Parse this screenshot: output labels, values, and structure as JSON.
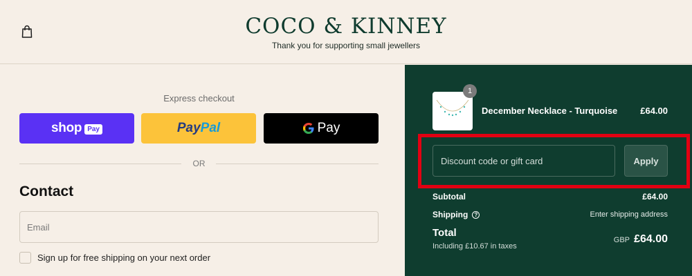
{
  "header": {
    "brand": "COCO & KINNEY",
    "tagline": "Thank you for supporting small jewellers",
    "cart_icon": "shopping-bag-icon"
  },
  "express": {
    "label": "Express checkout",
    "shop_pay": {
      "word": "shop",
      "pill": "Pay",
      "color": "#5a31f4"
    },
    "paypal": {
      "part1": "Pay",
      "part2": "Pal",
      "color": "#fcc33a"
    },
    "google_pay": {
      "word": "Pay",
      "color": "#000000"
    },
    "or_label": "OR"
  },
  "contact": {
    "title": "Contact",
    "email_placeholder": "Email",
    "newsletter_label": "Sign up for free shipping on your next order"
  },
  "summary": {
    "background": "#0f3d2f",
    "item": {
      "name": "December Necklace - Turquoise",
      "price": "£64.00",
      "quantity": "1"
    },
    "discount_placeholder": "Discount code or gift card",
    "apply_label": "Apply",
    "subtotal_label": "Subtotal",
    "subtotal_value": "£64.00",
    "shipping_label": "Shipping",
    "shipping_value": "Enter shipping address",
    "total_label": "Total",
    "tax_note": "Including £10.67 in taxes",
    "currency": "GBP",
    "total_value": "£64.00"
  }
}
